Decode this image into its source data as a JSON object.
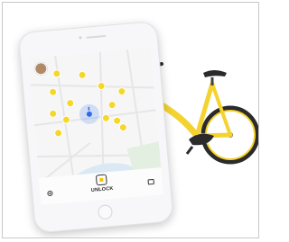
{
  "app": {
    "unlock_label": "UNLOCK"
  },
  "icons": {
    "avatar": "user-avatar",
    "marker": "bike-marker-icon",
    "locate": "locate-icon",
    "unlock": "unlock-icon",
    "wallet": "wallet-icon"
  },
  "colors": {
    "accent": "#f5c400",
    "bike_frame": "#f4d330",
    "user_location": "#2c6ee8"
  }
}
